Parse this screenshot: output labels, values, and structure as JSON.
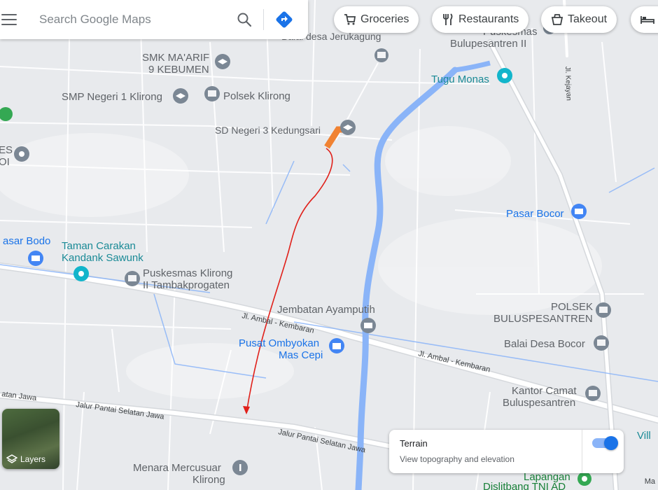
{
  "search": {
    "placeholder": "Search Google Maps"
  },
  "chips": [
    "Groceries",
    "Restaurants",
    "Takeout"
  ],
  "layers_label": "Layers",
  "terrain": {
    "title": "Terrain",
    "description": "View topography and elevation",
    "enabled": true
  },
  "attribution": "Ma",
  "places": [
    {
      "id": "balai-desa-jerukagung",
      "name": "Balai desa Jerukagung",
      "shown_text": "Balai desa Jerukagung",
      "type": "government",
      "color": "#7b8794"
    },
    {
      "id": "puskesmas-bulupesantren-2",
      "name": "Puskesmas Bulupesantren II",
      "lines": [
        "Puskesmas",
        "Bulupesantren II"
      ],
      "type": "health"
    },
    {
      "id": "smk-maarif",
      "lines": [
        "SMK MA'ARIF",
        "9 KEBUMEN"
      ],
      "type": "school"
    },
    {
      "id": "smp-negeri-1",
      "name": "SMP Negeri 1 Klirong",
      "type": "school"
    },
    {
      "id": "polsek-klirong",
      "name": "Polsek Klirong",
      "type": "government"
    },
    {
      "id": "sd-negeri-3",
      "name": "SD Negeri 3 Kedungsari",
      "type": "school"
    },
    {
      "id": "tugu-monas",
      "name": "Tugu Monas",
      "type": "attraction"
    },
    {
      "id": "pasar-bocor",
      "name": "Pasar Bocor",
      "type": "shopping"
    },
    {
      "id": "pasar-bodo",
      "name": "asar Bodo",
      "type": "shopping"
    },
    {
      "id": "taman-carakan",
      "lines": [
        "Taman Carakan",
        "Kandank Sawunk"
      ],
      "type": "attraction"
    },
    {
      "id": "puskesmas-klirong-2",
      "lines": [
        "Puskesmas Klirong",
        "II Tambakprogaten"
      ],
      "type": "health"
    },
    {
      "id": "jembatan-ayamputih",
      "name": "Jembatan Ayamputih",
      "type": "landmark"
    },
    {
      "id": "polsek-bulus",
      "lines": [
        "POLSEK",
        "BULUSPESANTREN"
      ],
      "type": "government"
    },
    {
      "id": "pusat-ombyokan",
      "lines": [
        "Pusat Ombyokan",
        "Mas Cepi"
      ],
      "type": "shopping"
    },
    {
      "id": "balai-desa-bocor",
      "name": "Balai Desa Bocor",
      "type": "government"
    },
    {
      "id": "kantor-camat",
      "lines": [
        "Kantor Camat",
        "Buluspesantren"
      ],
      "type": "government"
    },
    {
      "id": "menara-mercusuar",
      "lines": [
        "Menara Mercusuar",
        "Klirong"
      ],
      "type": "landmark"
    },
    {
      "id": "lapangan",
      "lines": [
        "Lapangan",
        "Dislitbang TNI AD"
      ],
      "type": "park"
    },
    {
      "id": "partial-left-es",
      "lines": [
        "ES",
        "OI"
      ],
      "type": "government"
    },
    {
      "id": "partial-vill",
      "name": "Vill",
      "type": "other"
    }
  ],
  "roads": [
    {
      "id": "jl-ambal-1",
      "name": "Jl. Ambal - Kembaran"
    },
    {
      "id": "jl-ambal-2",
      "name": "Jl. Ambal - Kembaran"
    },
    {
      "id": "jalur-pantai-1",
      "name": "Jalur Pantai Selatan Jawa"
    },
    {
      "id": "jalur-pantai-2",
      "name": "Jalur Pantai Selatan Jawa"
    },
    {
      "id": "jalan-jawa",
      "name": "atan Jawa"
    },
    {
      "id": "jl-kejayan",
      "name": "Jl. Kejayan"
    }
  ],
  "colors": {
    "map_bg": "#e8eaed",
    "road": "#ffffff",
    "river": "#8ab4f8",
    "school": "#7b8794",
    "attraction_label": "#1a8a96",
    "shopping_label": "#1a73e8",
    "government_label": "#5f6368",
    "route_arrow": "#e0201a",
    "highlight": "#f08232"
  }
}
